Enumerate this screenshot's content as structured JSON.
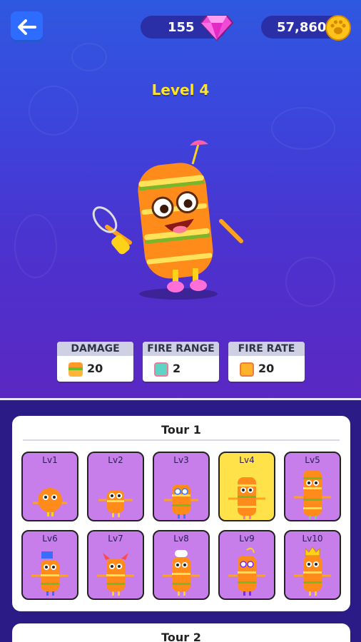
{
  "header": {
    "gems": "155",
    "coins": "57,860",
    "back_icon": "arrow-left-icon",
    "gem_icon": "pink-gem-icon",
    "coin_icon": "paw-coin-icon"
  },
  "hero": {
    "level_title": "Level 4"
  },
  "stats": [
    {
      "label": "DAMAGE",
      "value": "20",
      "icon": "burger-icon"
    },
    {
      "label": "FIRE RANGE",
      "value": "2",
      "icon": "range-icon"
    },
    {
      "label": "FIRE RATE",
      "value": "20",
      "icon": "rate-icon"
    }
  ],
  "tours": [
    {
      "title": "Tour 1",
      "levels": [
        "Lv1",
        "Lv2",
        "Lv3",
        "Lv4",
        "Lv5",
        "Lv6",
        "Lv7",
        "Lv8",
        "Lv9",
        "Lv10"
      ],
      "selected": "Lv4"
    },
    {
      "title": "Tour 2"
    }
  ],
  "colors": {
    "accent_yellow": "#ffe422",
    "cell_purple": "#c77eea",
    "cell_selected": "#ffe24a",
    "bottom_bg": "#2a1b86"
  }
}
